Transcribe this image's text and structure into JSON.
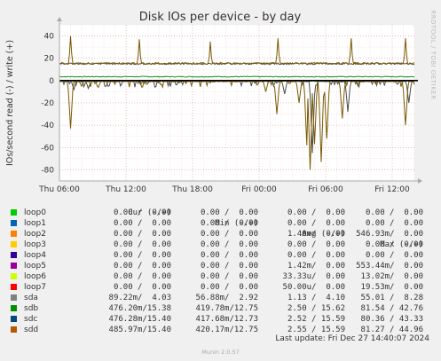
{
  "chart_data": {
    "type": "line",
    "title": "Disk IOs per device - by day",
    "ylabel": "IOs/second read (-) / write (+)",
    "side_label": "RRDTOOL / TOBI OETIKER",
    "ylim": [
      -90,
      50
    ],
    "yticks": [
      40,
      20,
      0,
      -20,
      -40,
      -60,
      -80
    ],
    "xlim": [
      0,
      32
    ],
    "xticks": [
      {
        "h": 0,
        "label": "Thu 06:00"
      },
      {
        "h": 6,
        "label": "Thu 12:00"
      },
      {
        "h": 12,
        "label": "Thu 18:00"
      },
      {
        "h": 18,
        "label": "Fri 00:00"
      },
      {
        "h": 24,
        "label": "Fri 06:00"
      },
      {
        "h": 30,
        "label": "Fri 12:00"
      }
    ],
    "grid": true,
    "series": [
      {
        "name": "sdb",
        "color": "#7a5800",
        "write_baseline": 15.4,
        "read_baseline": -0.4,
        "write_peaks": [
          [
            1.0,
            40
          ],
          [
            7.2,
            37
          ],
          [
            13.6,
            35
          ],
          [
            19.7,
            38
          ],
          [
            26.3,
            38
          ],
          [
            31.2,
            38
          ]
        ],
        "read_dips": [
          [
            1.0,
            -43
          ],
          [
            2.0,
            -5
          ],
          [
            3.5,
            -6
          ],
          [
            18.6,
            -10
          ],
          [
            19.6,
            -30
          ],
          [
            21.6,
            -20
          ],
          [
            22.3,
            -58
          ],
          [
            22.6,
            -80
          ],
          [
            23.0,
            -57
          ],
          [
            23.6,
            -73
          ],
          [
            24.1,
            -52
          ],
          [
            25.5,
            -34
          ],
          [
            31.2,
            -40
          ]
        ]
      },
      {
        "name": "sdc",
        "color": "#4d4d4d",
        "write_baseline": 15.2,
        "read_baseline": -0.5,
        "write_peaks": [],
        "read_dips": [
          [
            1.3,
            -8
          ],
          [
            2.6,
            -7
          ],
          [
            4.2,
            -5
          ],
          [
            20.3,
            -12
          ],
          [
            22.8,
            -65
          ],
          [
            26.0,
            -28
          ],
          [
            31.5,
            -20
          ]
        ]
      },
      {
        "name": "sda",
        "color": "#1a8c1a",
        "write_baseline": 3.5,
        "read_baseline": -0.2,
        "write_peaks": [],
        "read_dips": []
      }
    ],
    "legend": {
      "headers": [
        "Cur (-/+)",
        "Min (-/+)",
        "Avg (-/+)",
        "Max (-/+)"
      ],
      "rows": [
        {
          "name": "loop0",
          "color": "#00cc00",
          "cur": "0.00 /  0.00",
          "min": "0.00 /  0.00",
          "avg": "0.00 /  0.00",
          "max": "0.00 /  0.00"
        },
        {
          "name": "loop1",
          "color": "#0066b3",
          "cur": "0.00 /  0.00",
          "min": "0.00 /  0.00",
          "avg": "0.00 /  0.00",
          "max": "0.00 /  0.00"
        },
        {
          "name": "loop2",
          "color": "#ff8000",
          "cur": "0.00 /  0.00",
          "min": "0.00 /  0.00",
          "avg": "1.40m/  0.00",
          "max": "546.93m/  0.00"
        },
        {
          "name": "loop3",
          "color": "#ffcc00",
          "cur": "0.00 /  0.00",
          "min": "0.00 /  0.00",
          "avg": "0.00 /  0.00",
          "max": "0.00 /  0.00"
        },
        {
          "name": "loop4",
          "color": "#330099",
          "cur": "0.00 /  0.00",
          "min": "0.00 /  0.00",
          "avg": "0.00 /  0.00",
          "max": "0.00 /  0.00"
        },
        {
          "name": "loop5",
          "color": "#990099",
          "cur": "0.00 /  0.00",
          "min": "0.00 /  0.00",
          "avg": "1.42m/  0.00",
          "max": "553.44m/  0.00"
        },
        {
          "name": "loop6",
          "color": "#ccff00",
          "cur": "0.00 /  0.00",
          "min": "0.00 /  0.00",
          "avg": "33.33u/  0.00",
          "max": "13.02m/  0.00"
        },
        {
          "name": "loop7",
          "color": "#ff0000",
          "cur": "0.00 /  0.00",
          "min": "0.00 /  0.00",
          "avg": "50.00u/  0.00",
          "max": "19.53m/  0.00"
        },
        {
          "name": "sda",
          "color": "#808080",
          "cur": "89.22m/  4.03",
          "min": "56.88m/  2.92",
          "avg": "1.13 /  4.10",
          "max": "55.01 /  8.28"
        },
        {
          "name": "sdb",
          "color": "#008f00",
          "cur": "476.20m/15.38",
          "min": "419.78m/12.75",
          "avg": "2.50 / 15.62",
          "max": "81.54 / 42.76"
        },
        {
          "name": "sdc",
          "color": "#00487d",
          "cur": "476.28m/15.40",
          "min": "417.68m/12.73",
          "avg": "2.52 / 15.59",
          "max": "80.36 / 43.33"
        },
        {
          "name": "sdd",
          "color": "#b35a00",
          "cur": "485.97m/15.40",
          "min": "420.17m/12.75",
          "avg": "2.55 / 15.59",
          "max": "81.27 / 44.96"
        }
      ]
    },
    "last_update": "Last update:  Fri Dec 27 14:40:07 2024",
    "footer": "Munin 2.0.57"
  }
}
